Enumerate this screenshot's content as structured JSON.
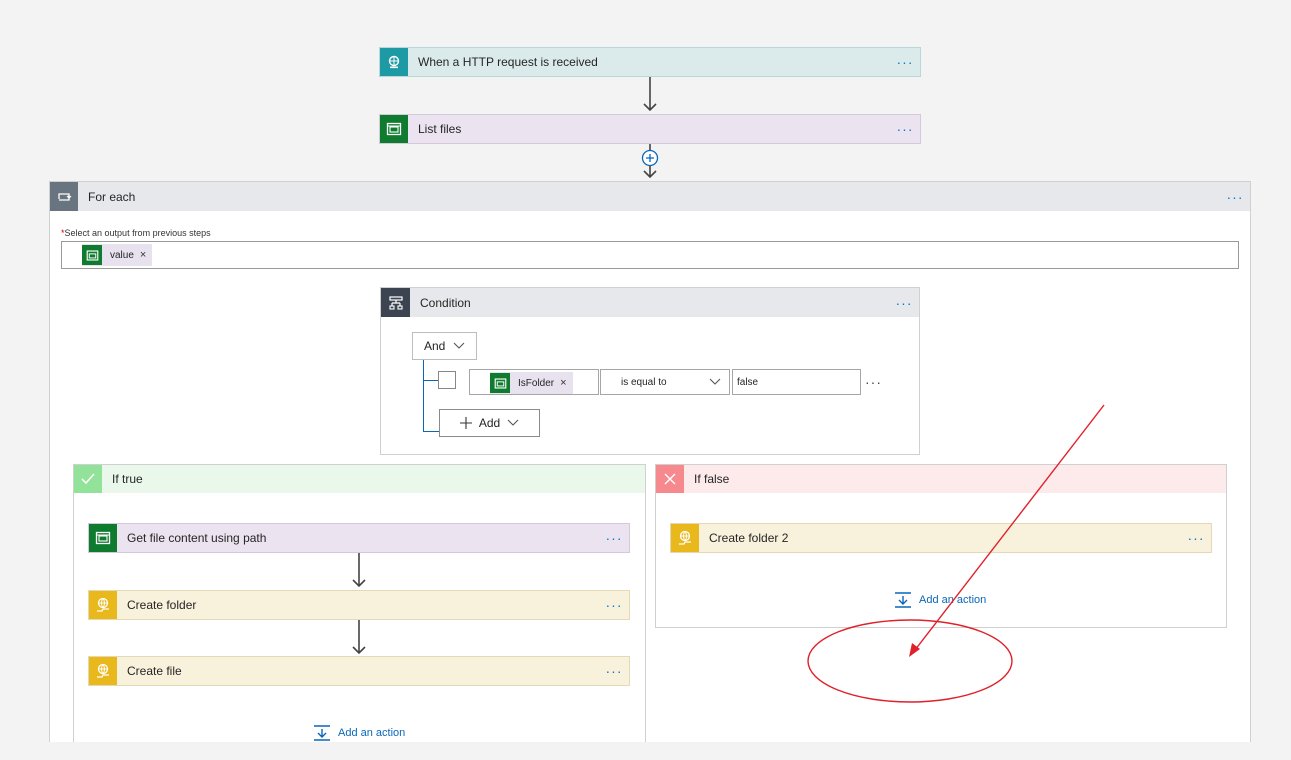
{
  "steps": {
    "http": {
      "label": "When a HTTP request is received",
      "more": "···",
      "icon": "http-request-icon"
    },
    "list_files": {
      "label": "List files",
      "more": "···",
      "icon": "sharepoint-icon"
    }
  },
  "foreach": {
    "title": "For each",
    "more": "···",
    "icon": "loop-icon",
    "required_mark": "*",
    "select_label": "Select an output from previous steps",
    "token": "value",
    "token_remove": "×"
  },
  "condition": {
    "title": "Condition",
    "more": "···",
    "icon": "condition-icon",
    "operator": "And",
    "row": {
      "token": "IsFolder",
      "token_remove": "×",
      "comparison": "is equal to",
      "value": "false",
      "more": "···"
    },
    "add_label": "Add"
  },
  "if_true": {
    "title": "If true",
    "header_color": "#92e29a",
    "actions": [
      {
        "label": "Get file content using path",
        "more": "···",
        "icon": "sharepoint-icon"
      },
      {
        "label": "Create folder",
        "more": "···",
        "icon": "ftp-icon"
      },
      {
        "label": "Create file",
        "more": "···",
        "icon": "ftp-icon"
      }
    ],
    "add_action": "Add an action"
  },
  "if_false": {
    "title": "If false",
    "header_color": "#f6898d",
    "actions": [
      {
        "label": "Create folder 2",
        "more": "···",
        "icon": "ftp-icon"
      }
    ],
    "add_action": "Add an action"
  },
  "colors": {
    "accent": "#0078d4",
    "annotation": "#e0202a"
  }
}
